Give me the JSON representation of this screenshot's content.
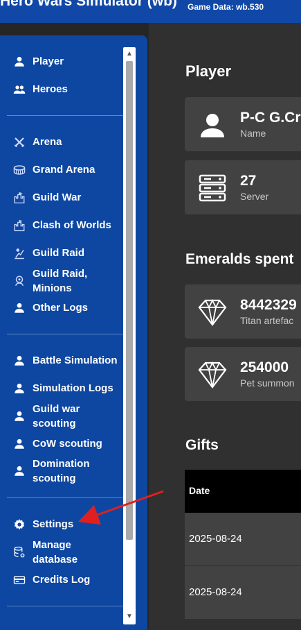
{
  "header": {
    "title": "Hero Wars Simulator (wb)",
    "game_data": "Game Data: wb.530"
  },
  "sidebar": {
    "group1": [
      {
        "label": "Player",
        "icon": "person-icon"
      },
      {
        "label": "Heroes",
        "icon": "group-icon"
      }
    ],
    "group2": [
      {
        "label": "Arena",
        "icon": "crossed-swords-icon"
      },
      {
        "label": "Grand Arena",
        "icon": "colosseum-icon"
      },
      {
        "label": "Guild War",
        "icon": "castle-icon"
      },
      {
        "label": "Clash of Worlds",
        "icon": "castle-icon"
      },
      {
        "label": "Guild Raid",
        "icon": "raid-icon"
      },
      {
        "label": "Guild Raid, Minions",
        "icon": "minions-icon"
      },
      {
        "label": "Other Logs",
        "icon": "person-icon"
      }
    ],
    "group3": [
      {
        "label": "Battle Simulation",
        "icon": "person-icon"
      },
      {
        "label": "Simulation Logs",
        "icon": "person-icon"
      },
      {
        "label": "Guild war scouting",
        "icon": "person-icon"
      },
      {
        "label": "CoW scouting",
        "icon": "person-icon"
      },
      {
        "label": "Domination scouting",
        "icon": "person-icon"
      }
    ],
    "group4": [
      {
        "label": "Settings",
        "icon": "gear-icon"
      },
      {
        "label": "Manage database",
        "icon": "database-icon"
      },
      {
        "label": "Credits Log",
        "icon": "credit-card-icon"
      }
    ]
  },
  "main": {
    "player_title": "Player",
    "name_value": "P-C G.Cr",
    "name_label": "Name",
    "server_value": "27",
    "server_label": "Server",
    "emeralds_title": "Emeralds spent",
    "emerald_card1_value": "8442329",
    "emerald_card1_label": "Titan artefac",
    "emerald_card2_value": "254000",
    "emerald_card2_label": "Pet summon",
    "gifts_title": "Gifts",
    "gifts_header": "Date",
    "gifts_rows": [
      "2025-08-24",
      "2025-08-24"
    ]
  },
  "colors": {
    "topbar": "#1148a8",
    "sidebar": "#0d47a1",
    "background": "#303030",
    "card": "#424242",
    "annotation_arrow": "#e02020"
  }
}
